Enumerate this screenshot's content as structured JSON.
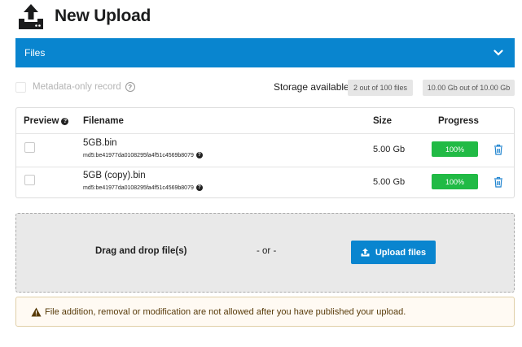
{
  "page": {
    "title": "New Upload",
    "icon": "upload-tray-icon"
  },
  "files_panel": {
    "label": "Files",
    "toggle_icon": "chevron-down-icon",
    "accent_color": "#0985cf"
  },
  "metadata": {
    "checkbox_label": "Metadata-only record",
    "help_icon": "question-circle-icon"
  },
  "storage": {
    "label": "Storage available",
    "files_count": "2 out of 100 files",
    "size_used": "10.00 Gb out of 10.00 Gb"
  },
  "table": {
    "headers": {
      "preview": "Preview",
      "filename": "Filename",
      "size": "Size",
      "progress": "Progress"
    },
    "rows": [
      {
        "filename": "5GB.bin",
        "checksum": "md5:be41977da0108295fa4f51c4569b8079",
        "size": "5.00 Gb",
        "progress": "100%",
        "progress_value": 100
      },
      {
        "filename": "5GB (copy).bin",
        "checksum": "md5:be41977da0108295fa4f51c4569b8079",
        "size": "5.00 Gb",
        "progress": "100%",
        "progress_value": 100
      }
    ],
    "progress_color": "#21ba45",
    "delete_icon": "trash-icon"
  },
  "dropzone": {
    "drag_text": "Drag and drop file(s)",
    "or_text": "- or -",
    "upload_button": "Upload files",
    "upload_icon": "upload-icon"
  },
  "warning": {
    "icon": "warning-triangle-icon",
    "text": "File addition, removal or modification are not allowed after you have published your upload."
  }
}
